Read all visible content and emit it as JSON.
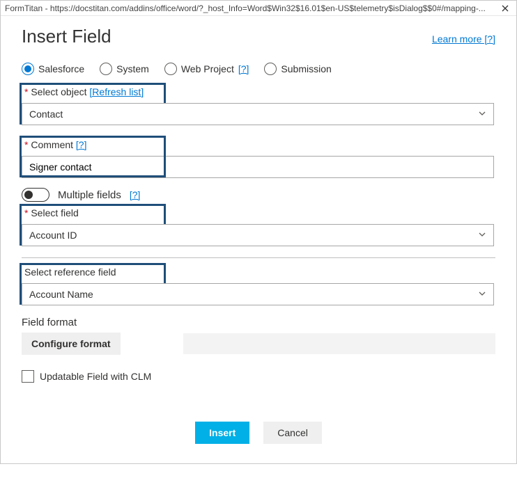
{
  "titlebar": "FormTitan - https://docstitan.com/addins/office/word/?_host_Info=Word$Win32$16.01$en-US$telemetry$isDialog$$0#/mapping-...",
  "header": {
    "title": "Insert Field",
    "learn_more": "Learn more [?]"
  },
  "source": {
    "salesforce": "Salesforce",
    "system": "System",
    "web_project": "Web Project",
    "web_project_help": "[?]",
    "submission": "Submission"
  },
  "object": {
    "label": "Select object",
    "refresh": "[Refresh list]",
    "value": "Contact"
  },
  "comment": {
    "label": "Comment",
    "help": "[?]",
    "value": "Signer contact"
  },
  "multiple_fields": {
    "label": "Multiple fields",
    "help": "[?]"
  },
  "field": {
    "label": "Select field",
    "value": "Account ID"
  },
  "reference_field": {
    "label": "Select reference field",
    "value": "Account Name"
  },
  "format": {
    "label": "Field format",
    "button": "Configure format"
  },
  "updatable": {
    "label": "Updatable Field with CLM"
  },
  "footer": {
    "insert": "Insert",
    "cancel": "Cancel"
  }
}
